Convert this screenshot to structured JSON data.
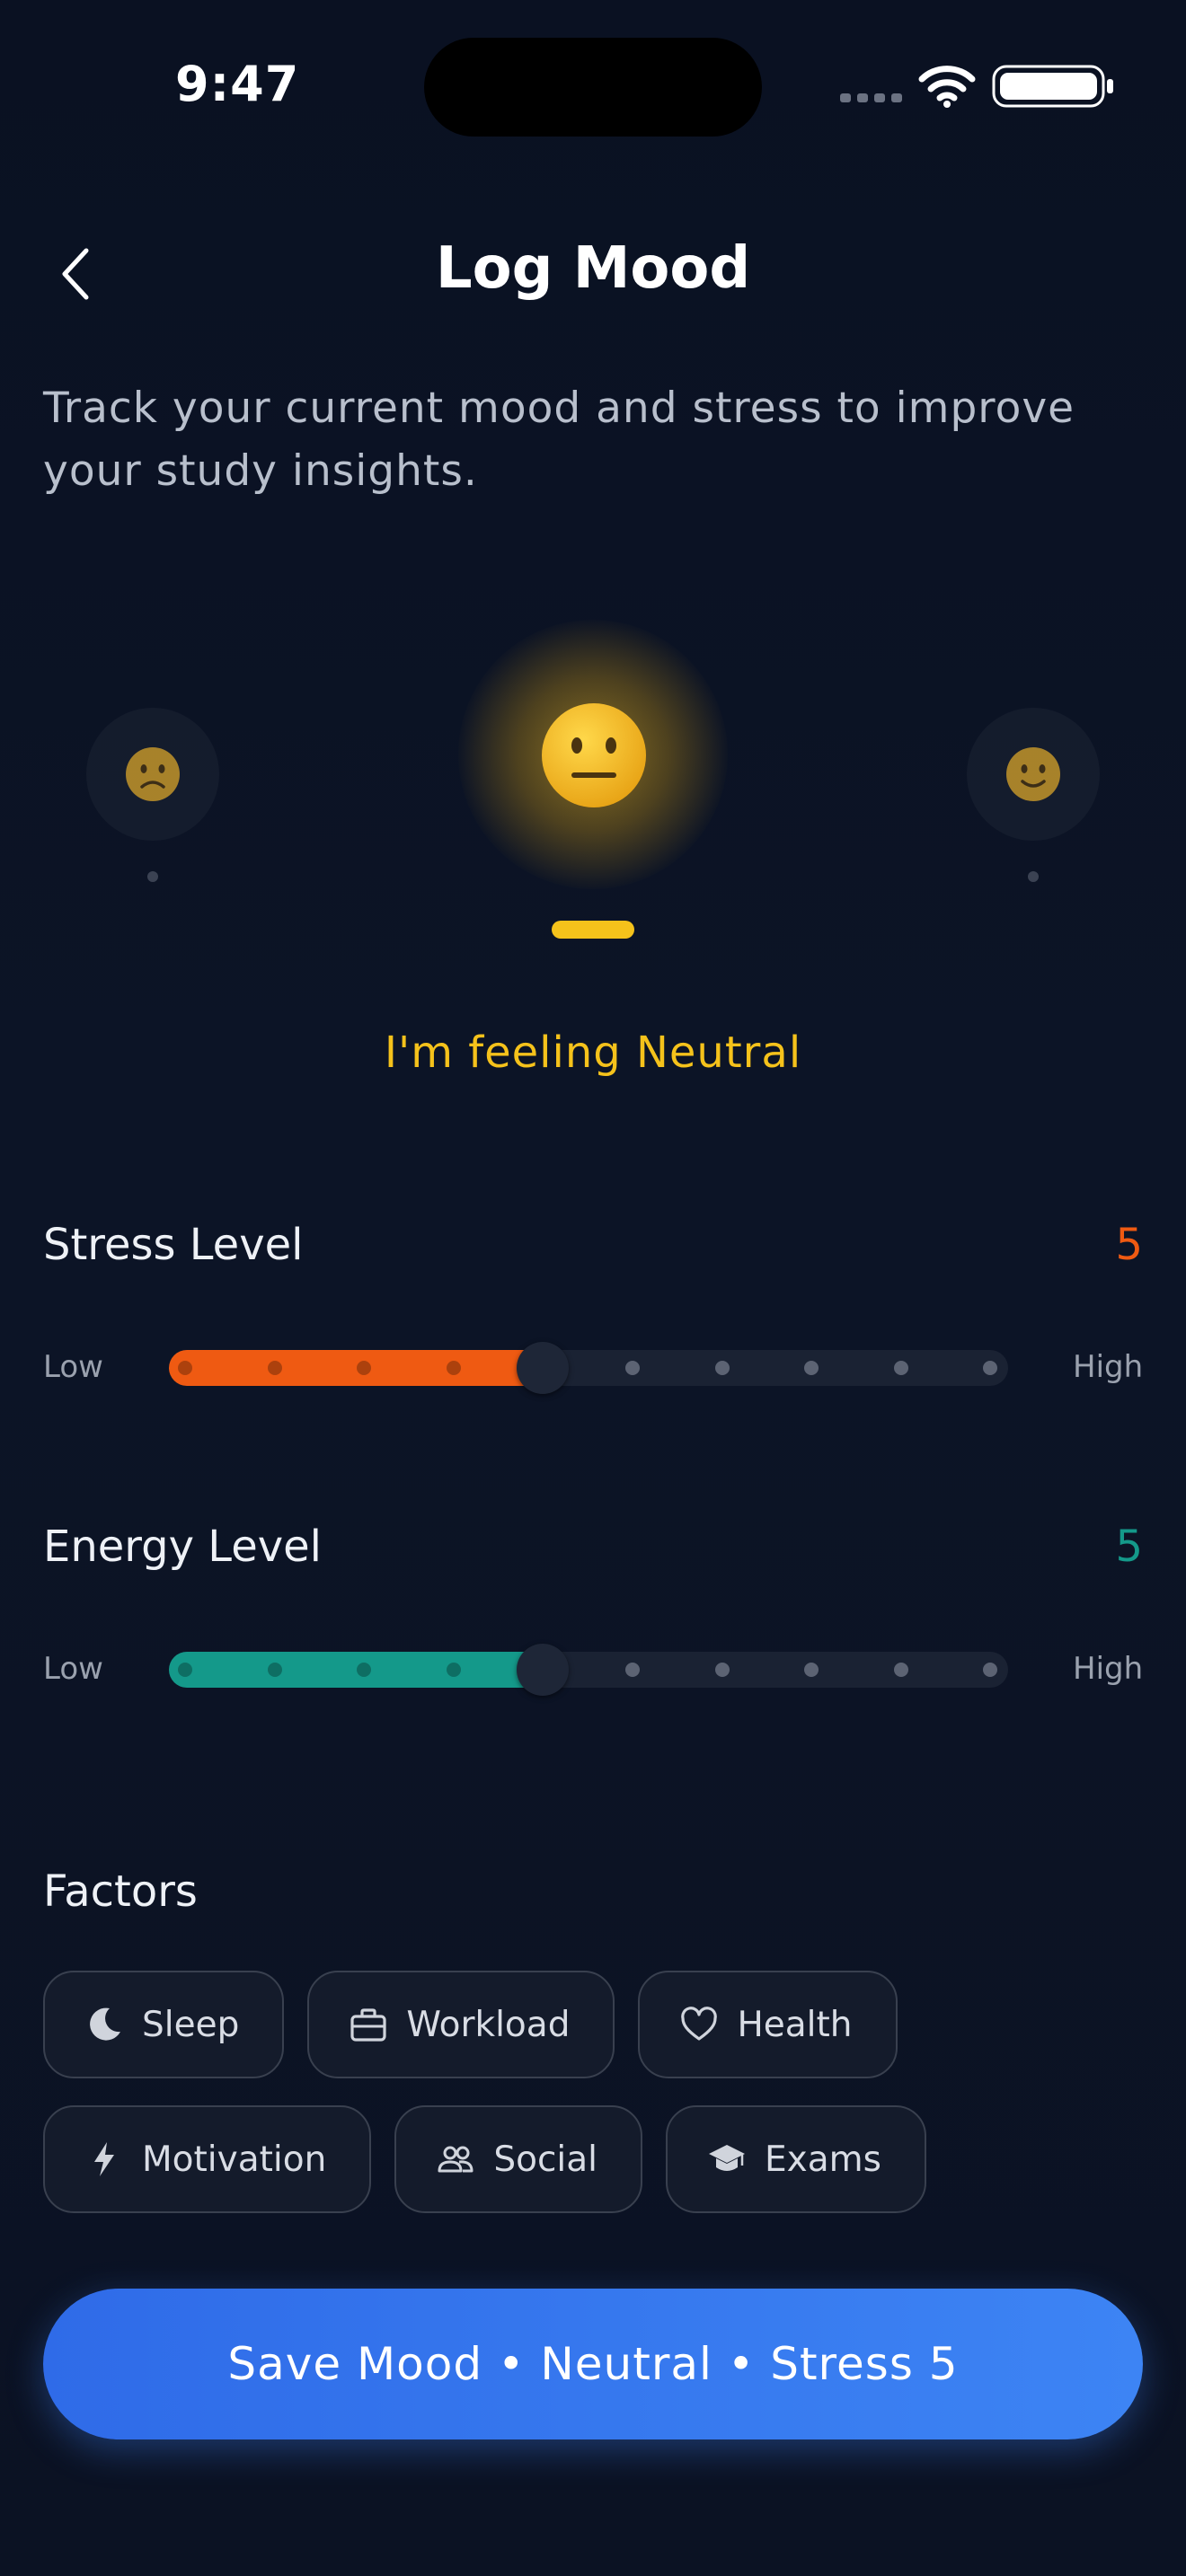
{
  "status": {
    "time": "9:47"
  },
  "header": {
    "title": "Log Mood"
  },
  "subtitle": "Track your current mood and stress to improve your study insights.",
  "mood": {
    "feeling_text": "I'm feeling Neutral",
    "colors": {
      "accent": "#f5c21b"
    },
    "icons": [
      "sad-face-icon",
      "neutral-face-icon",
      "happy-face-icon"
    ]
  },
  "stress": {
    "label": "Stress Level",
    "value": "5",
    "low": "Low",
    "high": "High",
    "color": "#ef5a12"
  },
  "energy": {
    "label": "Energy Level",
    "value": "5",
    "low": "Low",
    "high": "High",
    "color": "#14998a"
  },
  "factors": {
    "title": "Factors",
    "items": [
      {
        "label": "Sleep",
        "icon": "moon-icon"
      },
      {
        "label": "Workload",
        "icon": "briefcase-icon"
      },
      {
        "label": "Health",
        "icon": "heart-icon"
      },
      {
        "label": "Motivation",
        "icon": "bolt-icon"
      },
      {
        "label": "Social",
        "icon": "people-icon"
      },
      {
        "label": "Exams",
        "icon": "graduation-cap-icon"
      }
    ]
  },
  "save_button": {
    "label": "Save Mood • Neutral • Stress 5",
    "color": "#3b82f6"
  }
}
